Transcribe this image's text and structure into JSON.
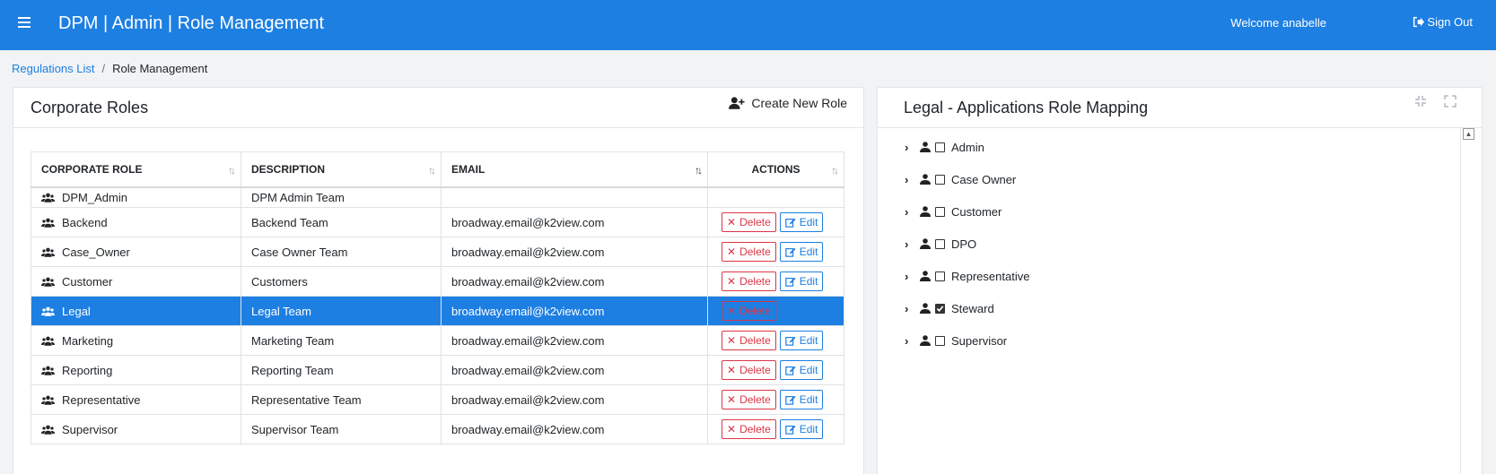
{
  "header": {
    "app_title": "DPM | Admin | Role Management",
    "welcome": "Welcome anabelle",
    "sign_out": "Sign Out"
  },
  "breadcrumb": {
    "link": "Regulations List",
    "separator": "/",
    "current": "Role Management"
  },
  "left_panel": {
    "title": "Corporate Roles",
    "create_label": "Create New Role",
    "columns": [
      "CORPORATE ROLE",
      "DESCRIPTION",
      "EMAIL",
      "ACTIONS"
    ],
    "delete_label": "Delete",
    "edit_label": "Edit",
    "rows": [
      {
        "role": "DPM_Admin",
        "description": "DPM Admin Team",
        "email": ""
      },
      {
        "role": "Backend",
        "description": "Backend Team",
        "email": "broadway.email@k2view.com"
      },
      {
        "role": "Case_Owner",
        "description": "Case Owner Team",
        "email": "broadway.email@k2view.com"
      },
      {
        "role": "Customer",
        "description": "Customers",
        "email": "broadway.email@k2view.com"
      },
      {
        "role": "Legal",
        "description": "Legal Team",
        "email": "broadway.email@k2view.com"
      },
      {
        "role": "Marketing",
        "description": "Marketing Team",
        "email": "broadway.email@k2view.com"
      },
      {
        "role": "Reporting",
        "description": "Reporting Team",
        "email": "broadway.email@k2view.com"
      },
      {
        "role": "Representative",
        "description": "Representative Team",
        "email": "broadway.email@k2view.com"
      },
      {
        "role": "Supervisor",
        "description": "Supervisor Team",
        "email": "broadway.email@k2view.com"
      }
    ]
  },
  "right_panel": {
    "title": "Legal -   Applications Role Mapping",
    "tree": [
      {
        "label": "Admin",
        "checked": false
      },
      {
        "label": "Case Owner",
        "checked": false
      },
      {
        "label": "Customer",
        "checked": false
      },
      {
        "label": "DPO",
        "checked": false
      },
      {
        "label": "Representative",
        "checked": false
      },
      {
        "label": "Steward",
        "checked": true
      },
      {
        "label": "Supervisor",
        "checked": false
      }
    ]
  },
  "icons": {
    "menu": "hamburger-icon",
    "sign_out": "sign-out-icon",
    "create": "user-plus-icon",
    "role": "users-icon",
    "edit": "edit-icon",
    "delete": "close-icon",
    "tree_expand": "chevron-right-icon",
    "tree_user": "user-icon",
    "compress": "compress-icon",
    "expand": "expand-icon"
  },
  "colors": {
    "primary": "#1d7fe2",
    "danger": "#dc3545"
  }
}
